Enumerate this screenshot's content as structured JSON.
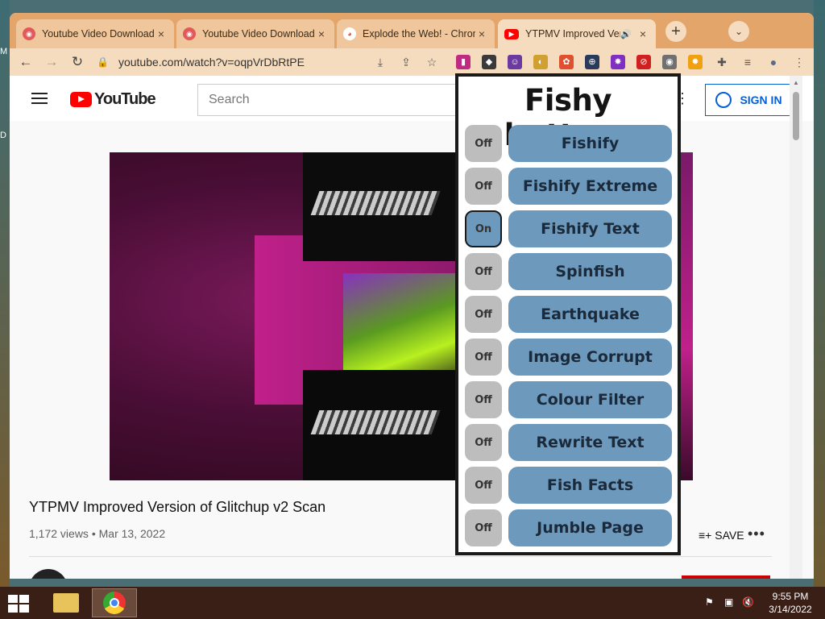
{
  "desktop": {
    "left_letters": [
      "M",
      "D"
    ]
  },
  "tabs": [
    {
      "title": "Youtube Video Downloader",
      "close": "×"
    },
    {
      "title": "Youtube Video Downloader",
      "close": "×"
    },
    {
      "title": "Explode the Web! - Chrome",
      "close": "×"
    },
    {
      "title": "YTPMV Improved Version",
      "close": "×",
      "audio": "🔊"
    }
  ],
  "tab_controls": {
    "new_tab": "+",
    "tab_search": "⌄"
  },
  "toolbar": {
    "url": "youtube.com/watch?v=oqpVrDbRtPE",
    "back": "←",
    "forward": "→",
    "reload": "↻",
    "lock": "🔒",
    "install": "⤓",
    "share": "⇪",
    "bookmark": "☆",
    "extensions": "✚",
    "media": "≡",
    "profile": "●",
    "menu": "⋮"
  },
  "extensions": [
    {
      "name": "rainbow-ext",
      "color": "#c02a80",
      "glyph": "▮"
    },
    {
      "name": "hat-ext",
      "color": "#3a3a3a",
      "glyph": "◆"
    },
    {
      "name": "alien-ext",
      "color": "#6a3aa0",
      "glyph": "☺"
    },
    {
      "name": "cat-ext",
      "color": "#d0a030",
      "glyph": "◐"
    },
    {
      "name": "paint-ext",
      "color": "#e05030",
      "glyph": "✿"
    },
    {
      "name": "crosshair-ext",
      "color": "#2a3a5a",
      "glyph": "⊕"
    },
    {
      "name": "burst-ext",
      "color": "#8030c0",
      "glyph": "✸"
    },
    {
      "name": "block-ext",
      "color": "#d02020",
      "glyph": "⊘"
    },
    {
      "name": "fish-ext",
      "color": "#707070",
      "glyph": "◉"
    },
    {
      "name": "sun-ext",
      "color": "#f0a010",
      "glyph": "✹"
    }
  ],
  "youtube": {
    "logo_text": "YouTube",
    "search_placeholder": "Search",
    "header_more": "⋮",
    "sign_in": "SIGN IN",
    "video_title": "YTPMV Improved Version of Glitchup v2 Scan",
    "views": "1,172 views",
    "separator": "•",
    "date": "Mar 13, 2022",
    "save": "SAVE",
    "save_icon": "≡+",
    "more": "•••"
  },
  "popup": {
    "title": "Fishy buttons",
    "buttons": [
      {
        "toggle": "Off",
        "label": "Fishify"
      },
      {
        "toggle": "Off",
        "label": "Fishify Extreme"
      },
      {
        "toggle": "On",
        "label": "Fishify Text"
      },
      {
        "toggle": "Off",
        "label": "Spinfish"
      },
      {
        "toggle": "Off",
        "label": "Earthquake"
      },
      {
        "toggle": "Off",
        "label": "Image Corrupt"
      },
      {
        "toggle": "Off",
        "label": "Colour Filter"
      },
      {
        "toggle": "Off",
        "label": "Rewrite Text"
      },
      {
        "toggle": "Off",
        "label": "Fish Facts"
      },
      {
        "toggle": "Off",
        "label": "Jumble Page"
      }
    ]
  },
  "taskbar": {
    "time": "9:55 PM",
    "date": "3/14/2022",
    "tray_icons": [
      "flag-icon",
      "network-icon",
      "volume-muted-icon"
    ],
    "tray_glyphs": [
      "⚑",
      "▣",
      "🔇"
    ]
  }
}
